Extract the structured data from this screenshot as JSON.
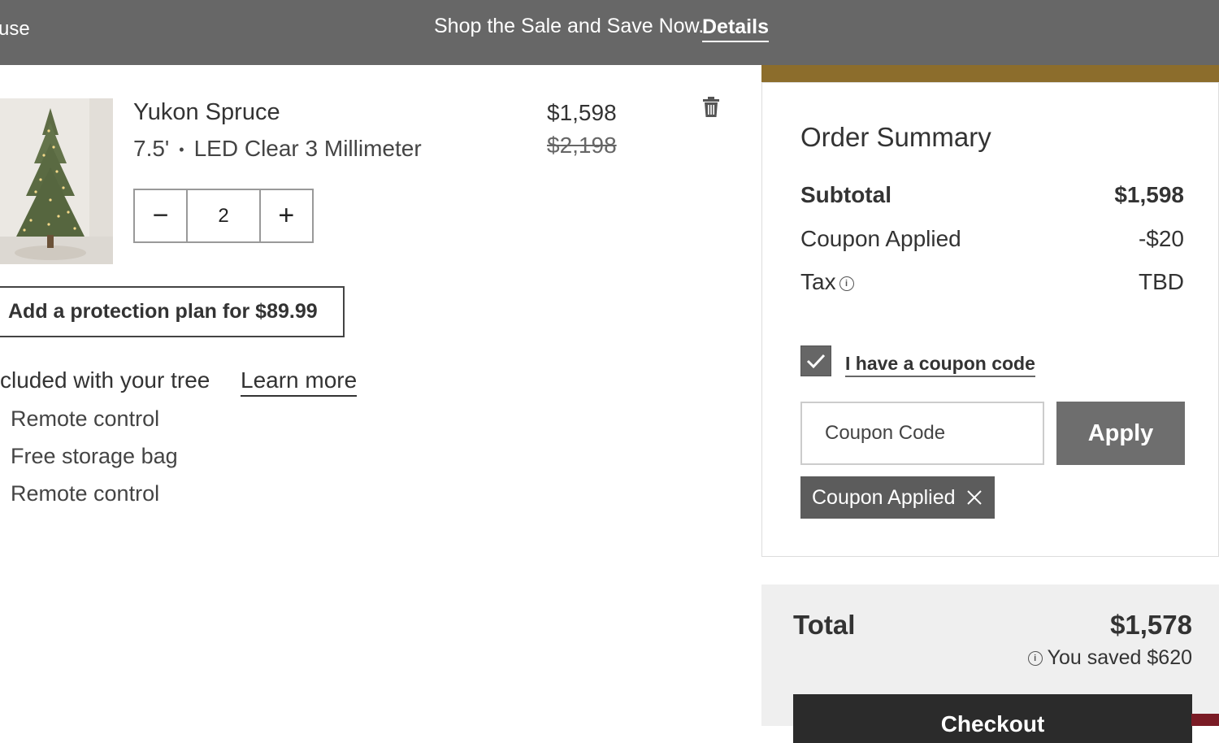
{
  "promo": {
    "left_text": "use",
    "message": "Shop the Sale and Save Now.",
    "details_link": "Details"
  },
  "product": {
    "name": "Yukon Spruce",
    "height": "7.5'",
    "separator": "•",
    "lights": "LED Clear 3 Millimeter",
    "price": "$1,598",
    "original_price": "$2,198",
    "quantity": "2",
    "decrement": "−",
    "increment": "+",
    "protection_plan": "Add a protection plan for $89.99",
    "included_heading": "cluded with your tree",
    "learn_more": "Learn more",
    "included_items": [
      "Remote control",
      "Free storage bag",
      "Remote control"
    ]
  },
  "summary": {
    "title": "Order Summary",
    "subtotal_label": "Subtotal",
    "subtotal_value": "$1,598",
    "coupon_label": "Coupon Applied",
    "coupon_value": "-$20",
    "tax_label": "Tax",
    "tax_value": "TBD",
    "coupon_checkbox_label": "I have a coupon code",
    "coupon_checked": true,
    "coupon_placeholder": "Coupon Code",
    "apply_label": "Apply",
    "applied_chip": "Coupon Applied"
  },
  "total": {
    "label": "Total",
    "value": "$1,578",
    "saved": "You saved $620",
    "checkout_label": "Checkout"
  },
  "colors": {
    "promo_bg": "#676767",
    "gold_accent": "#8c6d2c",
    "checkout_bg": "#2b2b2b"
  }
}
